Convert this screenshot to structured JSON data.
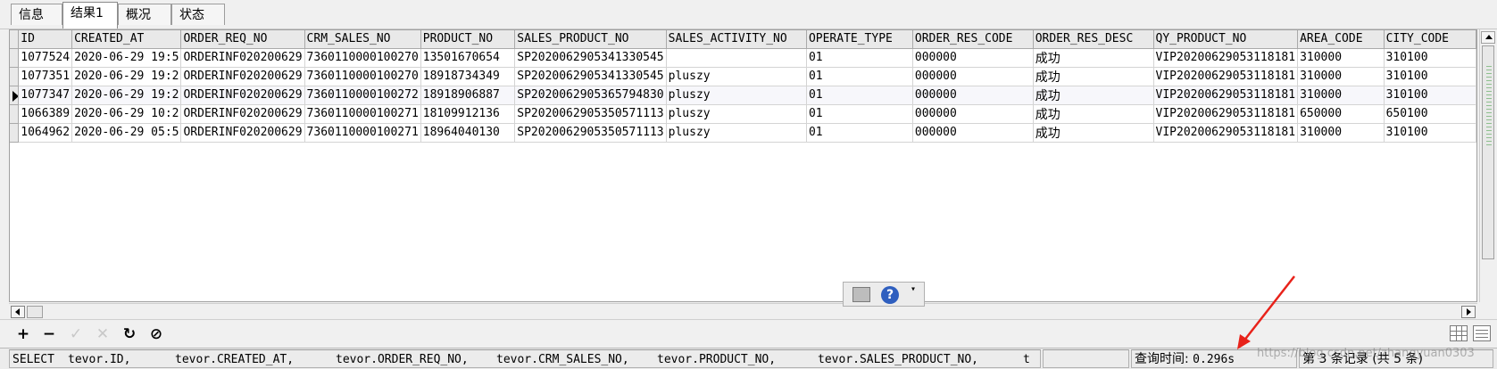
{
  "tabs": [
    "信息",
    "结果1",
    "概况",
    "状态"
  ],
  "active_tab": "结果1",
  "grid": {
    "columns": [
      "ID",
      "CREATED_AT",
      "ORDER_REQ_NO",
      "CRM_SALES_NO",
      "PRODUCT_NO",
      "SALES_PRODUCT_NO",
      "SALES_ACTIVITY_NO",
      "OPERATE_TYPE",
      "ORDER_RES_CODE",
      "ORDER_RES_DESC",
      "QY_PRODUCT_NO",
      "AREA_CODE",
      "CITY_CODE"
    ],
    "rows": [
      [
        "1077524",
        "2020-06-29 19:5",
        "ORDERINF020200629",
        "7360110000100270",
        "13501670654",
        "SP2020062905341330545",
        "",
        "01",
        "000000",
        "成功",
        "VIP20200629053118181",
        "310000",
        "310100"
      ],
      [
        "1077351",
        "2020-06-29 19:2",
        "ORDERINF020200629",
        "7360110000100270",
        "18918734349",
        "SP2020062905341330545",
        "pluszy",
        "01",
        "000000",
        "成功",
        "VIP20200629053118181",
        "310000",
        "310100"
      ],
      [
        "1077347",
        "2020-06-29 19:2",
        "ORDERINF020200629",
        "7360110000100272",
        "18918906887",
        "SP2020062905365794830",
        "pluszy",
        "01",
        "000000",
        "成功",
        "VIP20200629053118181",
        "310000",
        "310100"
      ],
      [
        "1066389",
        "2020-06-29 10:2",
        "ORDERINF020200629",
        "7360110000100271",
        "18109912136",
        "SP2020062905350571113",
        "pluszy",
        "01",
        "000000",
        "成功",
        "VIP20200629053118181",
        "650000",
        "650100"
      ],
      [
        "1064962",
        "2020-06-29 05:5",
        "ORDERINF020200629",
        "7360110000100271",
        "18964040130",
        "SP2020062905350571113",
        "pluszy",
        "01",
        "000000",
        "成功",
        "VIP20200629053118181",
        "310000",
        "310100"
      ]
    ],
    "selected_row": 2
  },
  "toolbar": {
    "add": "+",
    "remove": "−",
    "apply": "✓",
    "discard": "✕",
    "refresh": "↻",
    "stop": "⊘"
  },
  "mini_toolbar": {
    "help": "?",
    "menu": "▾"
  },
  "status": {
    "sql_parts": [
      "SELECT",
      "tevor.ID,",
      "tevor.CREATED_AT,",
      "tevor.ORDER_REQ_NO,",
      "tevor.CRM_SALES_NO,",
      "tevor.PRODUCT_NO,",
      "tevor.SALES_PRODUCT_NO,",
      "t"
    ],
    "query_time_label": "查询时间:",
    "query_time_value": "0.296s",
    "record_info": "第 3 条记录 (共 5 条)"
  },
  "watermark": "https://blog.csdn.net/zhangyuan0303",
  "colors": {
    "annotation_arrow": "#e8221a",
    "help_icon": "#2f5fbf"
  },
  "icons": [
    "add-icon",
    "remove-icon",
    "apply-icon",
    "discard-icon",
    "refresh-icon",
    "stop-icon",
    "printer-icon",
    "help-icon",
    "grid-view-icon",
    "form-view-icon"
  ]
}
